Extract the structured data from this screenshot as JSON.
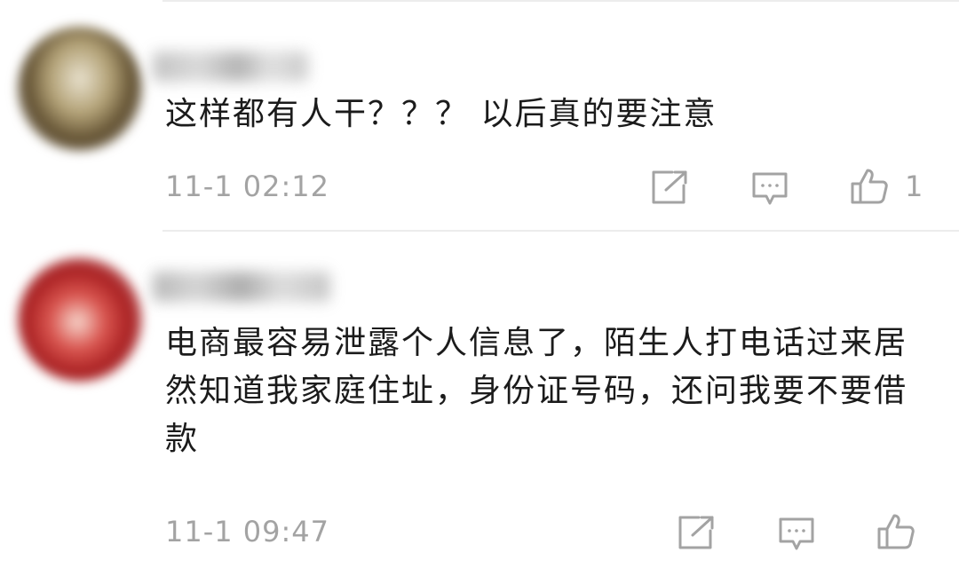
{
  "colors": {
    "text": "#1b1b1b",
    "meta": "#a3a3a3",
    "icon": "#a3a3a3",
    "divider": "#ececec"
  },
  "comments": [
    {
      "text": "这样都有人干？？？ 以后真的要注意",
      "time": "11-1 02:12",
      "icons": [
        "share-icon",
        "reply-icon",
        "thumbs-up-icon"
      ],
      "like_count": "1"
    },
    {
      "text": "电商最容易泄露个人信息了，陌生人打电话过来居然知道我家庭住址，身份证号码，还问我要不要借款",
      "time": "11-1 09:47",
      "icons": [
        "share-icon",
        "reply-icon",
        "thumbs-up-icon"
      ],
      "like_count": ""
    }
  ]
}
